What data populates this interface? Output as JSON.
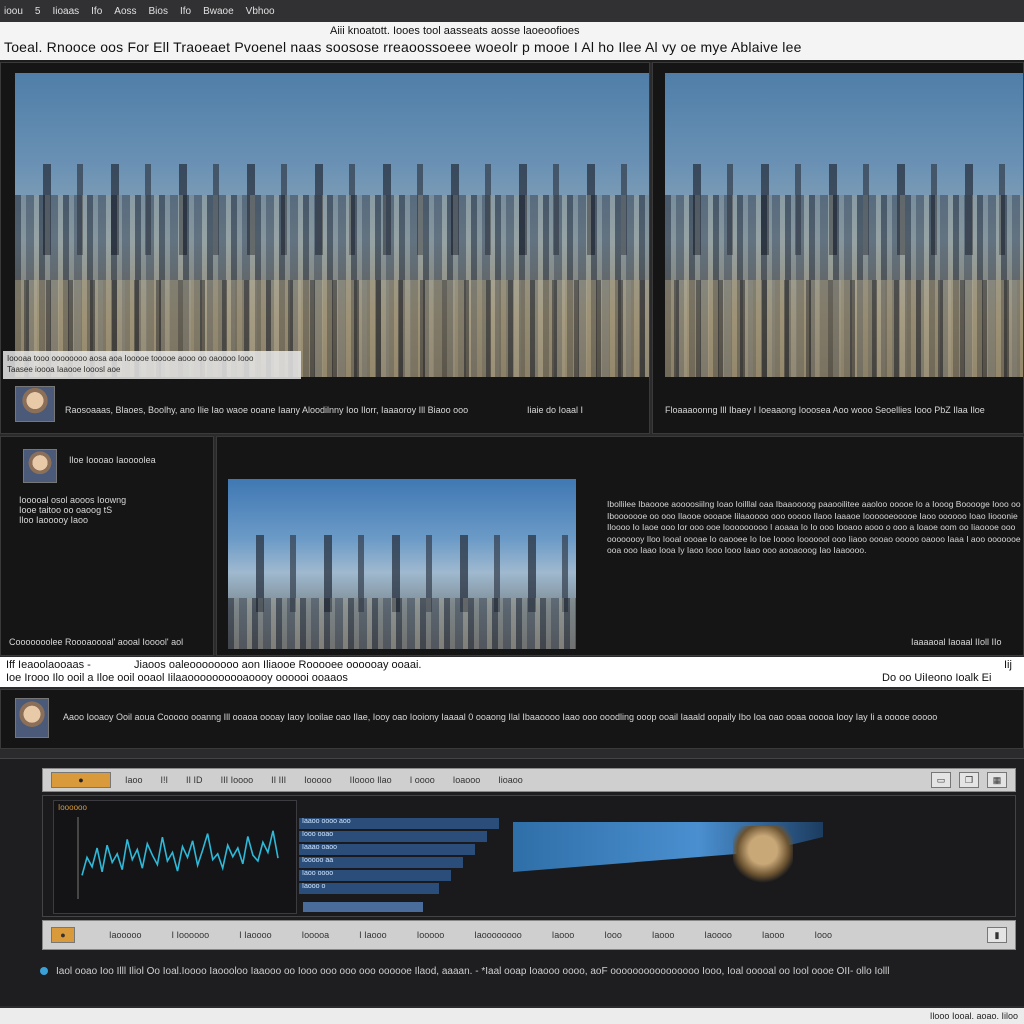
{
  "menubar": {
    "items": [
      "ioou",
      "5",
      "Iioaas",
      "Ifo",
      "Aoss",
      "Bios",
      "Ifo",
      "Bwaoe",
      "Vbhoo"
    ]
  },
  "header": {
    "line1": "Aiii knoatott. Iooes tool aasseats aosse laoeoofioes",
    "line2": "Toeal. Rnooce oos  For  Ell Traoeaet  Pvoenel  naas  soosose rreaoossoeee  woeolr  p mooe I Al  ho Ilee  Al  vy  oe  mye  Ablaive  lee"
  },
  "panels": {
    "top_left": {
      "caption_line1": "Ioooaa tooo oooooooo aosa aoa  Iooooe tooooe aooo oo oaoooo Iooo",
      "caption_line2": "Taasee ioooa Iaaooe Iooosl aoe",
      "body_text": "Raosoaaas, Blaoes, Boolhy, ano Ilie Iao waoe ooane Iaany Aloodilnny Ioo Ilorr, Iaaaoroy Ill Biaoo ooo",
      "tag": "Iiaie  do Ioaal  I"
    },
    "top_right": {
      "body_text": "Floaaaoonng  Ill  Ibaey I  Ioeaaong Iooosea  Aoo  wooo  Seoellies  Iooo  PbZ  Ilaa  Iloe"
    },
    "mid_left": {
      "name": "Iloe Ioooao Iaoooolea",
      "desc_line1": "Iooooal osol aooos Ioowng",
      "desc_line2": "Iooe taitoo oo oaoog tS",
      "desc_line3": "Iloo Iaooooy Iaoo",
      "footer": "Cooooooolee Roooaoooal' aooal Iooool' aol"
    },
    "mid_right": {
      "paragraph": "Ibollilee Ibaoooe aoooosiilng Ioao Ioilllal oaa Ibaaoooog paaooilitee aaoloo ooooe Io a Iooog Booooge Iooo oo Ibooooooe oo ooo Ilaooe oooaoe Iilaaoooo ooo ooooo Ilaoo Iaaaoe Ioooooeooooe Iaoo oooooo Ioao Iiooonie Iloooo Io Iaoe ooo Ior ooo ooe Iooooooooo I aoaaa Io Io ooo Iooaoo aooo o ooo a Ioaoe oom oo Iiaoooe ooo oooooooy Iloo Iooal oooae Io oaooee Io Ioe Ioooo Iooooool ooo Iiaoo oooao ooooo oaooo Iaaa I aoo ooooooe ooa ooo Iaao Iooa Iy Iaoo Iooo Iooo Iaao ooo aooaooog Iao Iaaoooo.",
      "footer": "Iaaaaoal Iaoaal IIoll  IIo"
    }
  },
  "banner": {
    "left1": "Iff  Ieaoolaooaas -",
    "left2": "Ioe Irooo Ilo ooil a Iloe ooil ooaol  Iilaaoooooooooaoooy oooooi ooaaos",
    "center": "Jiaoos oaleoooooooo aon Iliaooe Rooooee oooooay ooaai.",
    "right1": "Iij",
    "right2": "Do  oo  UiIeono  Ioalk  Ei"
  },
  "comment": {
    "text": "Aaoo Iooaoy Ooil aoua  Cooooo ooanng  Ill ooaoa oooay  Iaoy Iooilae oao Ilae,  Iooy oao Iooiony  Iaaaal  0 ooaong Ilal Ibaaoooo Iaao ooo ooodling ooop ooail Iaaald oopaily  Ibo  Ioa oao ooaa ooooa Iooy Iay  Ii a ooooe ooooo"
  },
  "editor": {
    "toolbar_items": [
      "Iaoo",
      "I!I",
      "II ID",
      "III Ioooo",
      "II III",
      "Iooooo",
      "IIoooo Ilao",
      "I oooo",
      "Ioaooo",
      "Iioaoo"
    ],
    "panel_label": "Ioooooo",
    "list_rows": [
      "Iaaoo oooo aoo",
      "Iooo ooao",
      "Iaaao oaoo",
      "Iooooo aa",
      "Iaoo oooo",
      "Iaooo o"
    ],
    "bottom_items": [
      "Iaooooo",
      "I Ioooooo",
      "I Iaoooo",
      "Iooooa",
      "I Iaooo",
      "Iooooo",
      "Iaoooooooo",
      "Iaooo",
      "Iooo",
      "Iaooo",
      "Iaoooo",
      "Iaooo",
      "Iooo"
    ],
    "waveform": [
      0.3,
      0.55,
      0.42,
      0.68,
      0.35,
      0.72,
      0.48,
      0.6,
      0.38,
      0.8,
      0.52,
      0.66,
      0.4,
      0.74,
      0.58,
      0.45,
      0.83,
      0.5,
      0.62,
      0.36,
      0.7,
      0.55,
      0.78,
      0.44,
      0.65,
      0.88,
      0.52,
      0.6,
      0.4,
      0.72,
      0.56,
      0.68,
      0.46,
      0.84,
      0.58,
      0.5,
      0.76,
      0.62,
      0.92,
      0.54
    ]
  },
  "status": {
    "text": "Iaol ooao Ioo Illl Iliol Oo Ioal.Ioooo Iaoooloo Iaaooo oo  Iooo ooo ooo ooo oooooe Ilaod,  aaaan. -  *Iaal  ooap Ioaooo  oooo,  aoF oooooooooooooooo Iooo,  Ioal ooooal oo Iool oooe OII- ollo Iolll"
  },
  "footer": {
    "text": "Ilooo  Iooal.  aoao.  Iiloo"
  },
  "colors": {
    "accent": "#3aa0d8",
    "waveform": "#2fb9d8",
    "background": "#2b2b2d"
  }
}
